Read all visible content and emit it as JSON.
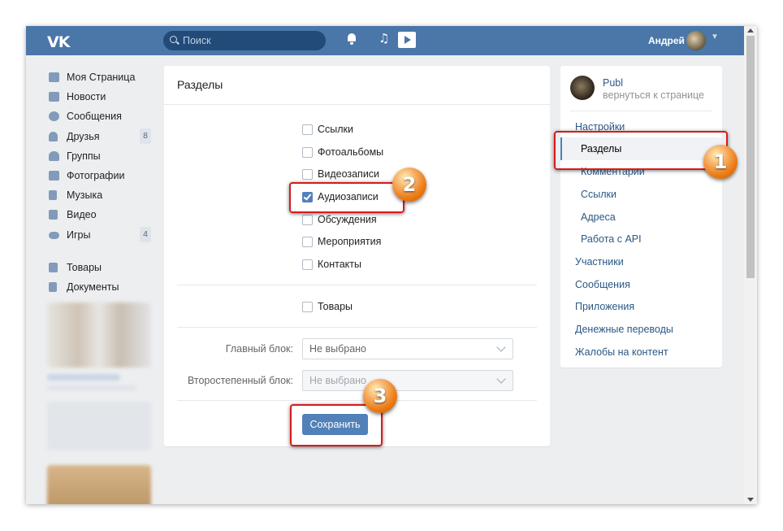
{
  "header": {
    "logo": "VK",
    "search_placeholder": "Поиск",
    "user_name": "Андрей",
    "icons": [
      "bell-icon",
      "music-note-icon",
      "play-icon",
      "search-icon",
      "chevron-down-icon"
    ]
  },
  "sidebar": {
    "items": [
      {
        "label": "Моя Страница",
        "icon": "home-icon"
      },
      {
        "label": "Новости",
        "icon": "news-icon"
      },
      {
        "label": "Сообщения",
        "icon": "message-icon"
      },
      {
        "label": "Друзья",
        "icon": "person-icon",
        "badge": "8"
      },
      {
        "label": "Группы",
        "icon": "group-icon"
      },
      {
        "label": "Фотографии",
        "icon": "camera-icon"
      },
      {
        "label": "Музыка",
        "icon": "music-icon"
      },
      {
        "label": "Видео",
        "icon": "film-icon"
      },
      {
        "label": "Игры",
        "icon": "gamepad-icon",
        "badge": "4"
      }
    ],
    "items2": [
      {
        "label": "Товары",
        "icon": "bag-icon"
      },
      {
        "label": "Документы",
        "icon": "document-icon"
      }
    ]
  },
  "main": {
    "title": "Разделы",
    "sections": [
      {
        "label": "Ссылки",
        "checked": false
      },
      {
        "label": "Фотоальбомы",
        "checked": false
      },
      {
        "label": "Видеозаписи",
        "checked": false
      },
      {
        "label": "Аудиозаписи",
        "checked": true
      },
      {
        "label": "Обсуждения",
        "checked": false
      },
      {
        "label": "Мероприятия",
        "checked": false
      },
      {
        "label": "Контакты",
        "checked": false
      }
    ],
    "goods": {
      "label": "Товары",
      "checked": false
    },
    "main_block": {
      "label": "Главный блок:",
      "value": "Не выбрано"
    },
    "secondary_block": {
      "label": "Второстепенный блок:",
      "value": "Не выбрано"
    },
    "save_label": "Сохранить"
  },
  "right": {
    "community_name": "Publ",
    "back_link": "вернуться к странице",
    "menu": [
      {
        "label": "Настройки",
        "active": false,
        "sub": false
      },
      {
        "label": "Разделы",
        "active": true,
        "sub": true
      },
      {
        "label": "Комментарии",
        "active": false,
        "sub": true
      },
      {
        "label": "Ссылки",
        "active": false,
        "sub": true
      },
      {
        "label": "Адреса",
        "active": false,
        "sub": true
      },
      {
        "label": "Работа с API",
        "active": false,
        "sub": true
      },
      {
        "label": "Участники",
        "active": false,
        "sub": false
      },
      {
        "label": "Сообщения",
        "active": false,
        "sub": false
      },
      {
        "label": "Приложения",
        "active": false,
        "sub": false
      },
      {
        "label": "Денежные переводы",
        "active": false,
        "sub": false
      },
      {
        "label": "Жалобы на контент",
        "active": false,
        "sub": false
      }
    ]
  },
  "annotations": {
    "step1": "1",
    "step2": "2",
    "step3": "3",
    "highlight_color": "#d71b1b"
  }
}
